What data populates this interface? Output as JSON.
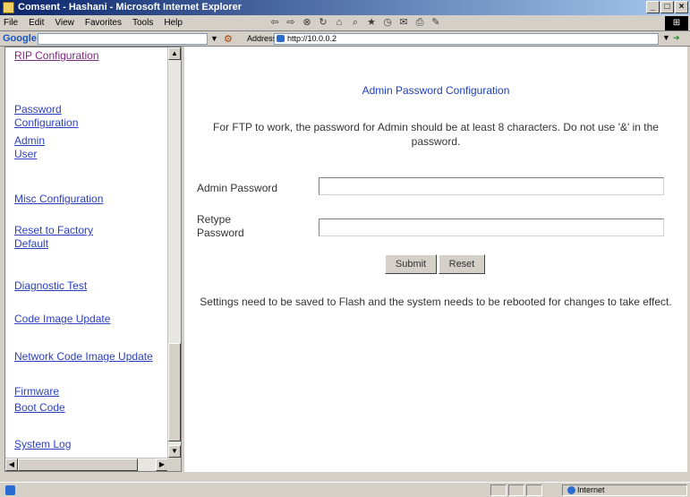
{
  "window": {
    "title": "Comsent - Hashani - Microsoft Internet Explorer"
  },
  "menu": {
    "items": [
      "File",
      "Edit",
      "View",
      "Favorites",
      "Tools",
      "Help"
    ]
  },
  "googlebar": {
    "logo": "Google -"
  },
  "address": {
    "label": "Address",
    "value": "http://10.0.0.2"
  },
  "nav": {
    "items": [
      {
        "label": "RIP Configuration",
        "visited": true
      },
      {
        "label": "Password Configuration",
        "visited": false
      },
      {
        "label": "Admin",
        "visited": false
      },
      {
        "label": "User",
        "visited": false
      },
      {
        "label": "Misc Configuration",
        "visited": false
      },
      {
        "label": "Reset to Factory Default",
        "visited": false
      },
      {
        "label": "Diagnostic Test",
        "visited": false
      },
      {
        "label": "Code Image Update",
        "visited": false
      },
      {
        "label": "Network Code Image Update",
        "visited": false
      },
      {
        "label": "Firmware",
        "visited": false
      },
      {
        "label": "Boot Code",
        "visited": false
      },
      {
        "label": "System Log",
        "visited": false
      }
    ]
  },
  "main": {
    "title": "Admin Password Configuration",
    "notice": "For FTP to work, the password for Admin should be at least 8 characters. Do not use '&' in the password.",
    "fields": [
      {
        "label": "Admin Password",
        "value": ""
      },
      {
        "label": "Retype Password",
        "value": ""
      }
    ],
    "submit_label": "Submit",
    "reset_label": "Reset",
    "footnote": "Settings need to be saved to Flash and the system needs to be rebooted for changes to take effect."
  },
  "status": {
    "zone": "Internet"
  },
  "colors": {
    "link": "#2a3fbf",
    "visited": "#7a2a7a",
    "title": "#1a3fbf"
  }
}
